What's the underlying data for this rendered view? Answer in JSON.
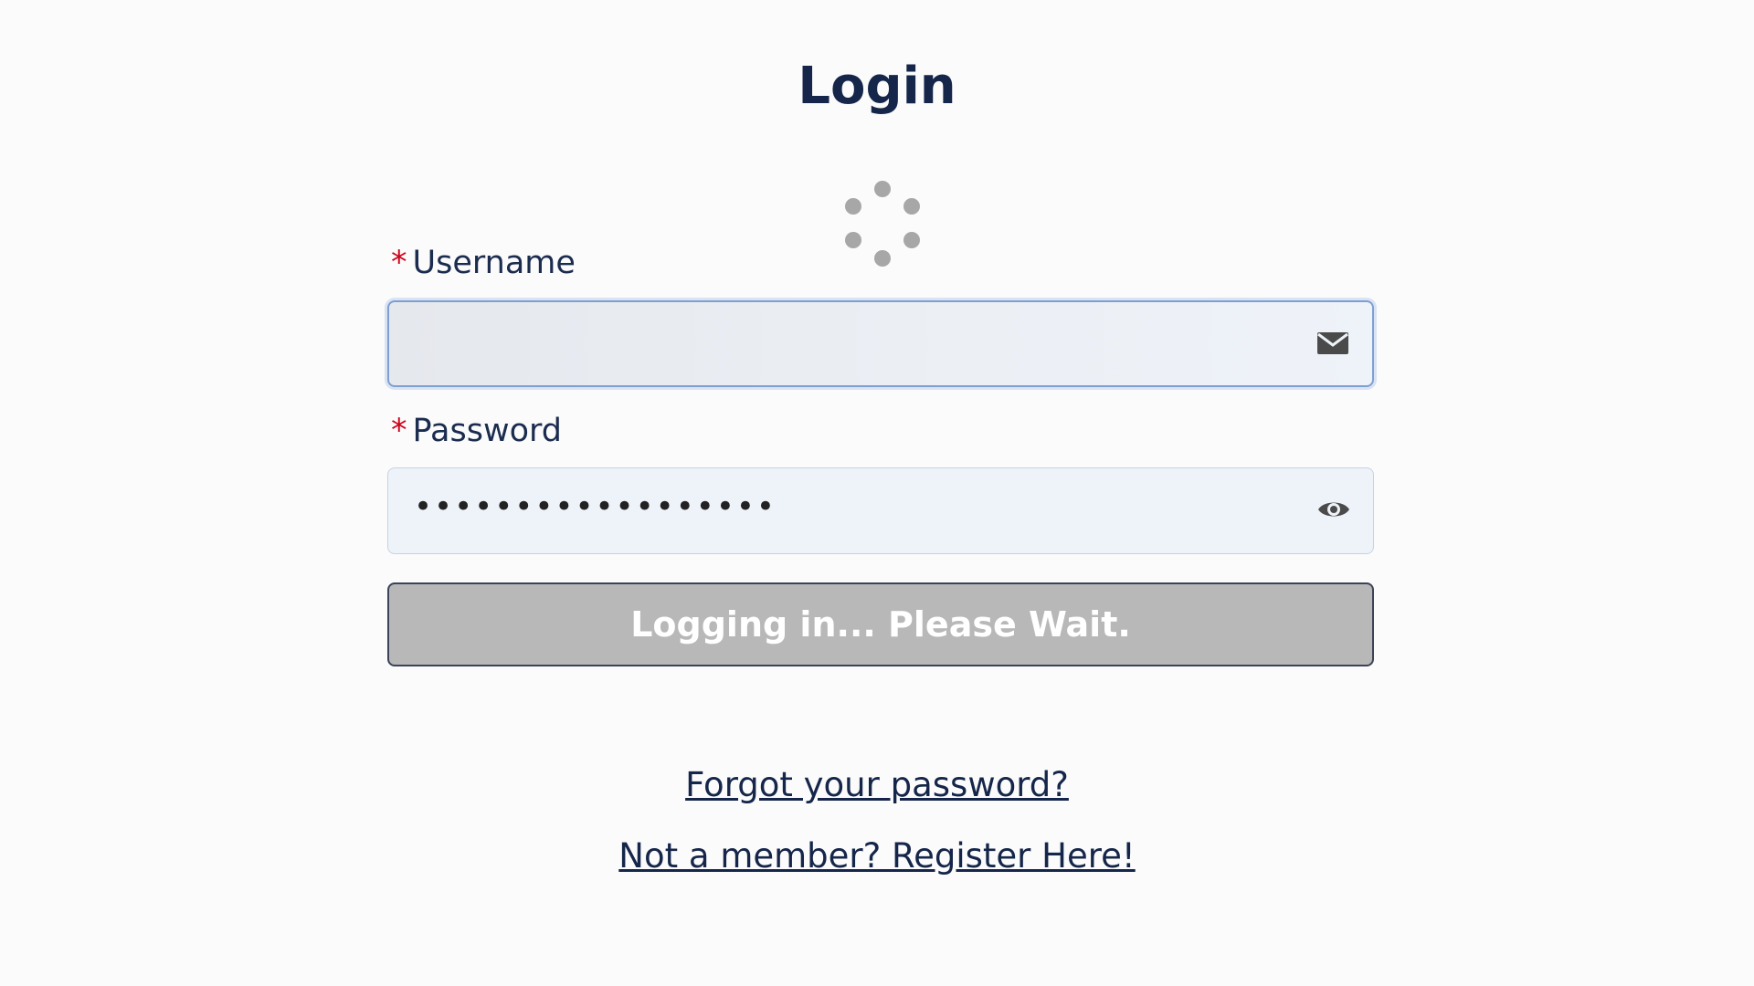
{
  "page": {
    "title": "Login"
  },
  "spinner": {
    "icon": "loading-spinner-icon"
  },
  "username": {
    "label": "Username",
    "required_marker": "*",
    "value": "",
    "icon": "envelope-icon"
  },
  "password": {
    "label": "Password",
    "required_marker": "*",
    "value": "••••••••••••••••••",
    "icon": "eye-icon"
  },
  "login_button": {
    "label": "Logging in... Please Wait."
  },
  "links": {
    "forgot_password": "Forgot your password?",
    "register": "Not a member? Register Here!"
  },
  "colors": {
    "title": "#15264a",
    "required": "#d0021b",
    "button_bg": "#b8b8b8",
    "input_focus_border": "#7d9fd1"
  }
}
